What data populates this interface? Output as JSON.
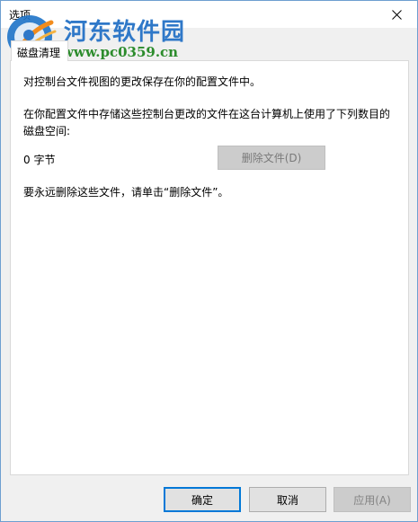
{
  "window": {
    "title": "选项",
    "close_symbol": "✕"
  },
  "watermark": {
    "site_name": "河东软件园",
    "url": "www.pc0359.cn"
  },
  "tabs": [
    {
      "label": "磁盘清理",
      "selected": true
    }
  ],
  "panel": {
    "description": "对控制台文件视图的更改保存在你的配置文件中。",
    "storage_note": "在你配置文件中存储这些控制台更改的文件在这台计算机上使用了下列数目的磁盘空间:",
    "size_value": "0 字节",
    "delete_button": "删除文件(D)",
    "delete_enabled": false,
    "hint": "要永远删除这些文件，请单击“删除文件”。"
  },
  "footer": {
    "ok": "确定",
    "cancel": "取消",
    "apply": "应用(A)",
    "apply_enabled": false
  },
  "colors": {
    "accent": "#0078d7",
    "watermark_title": "#2f78c8",
    "watermark_url": "#2c8c2c"
  }
}
